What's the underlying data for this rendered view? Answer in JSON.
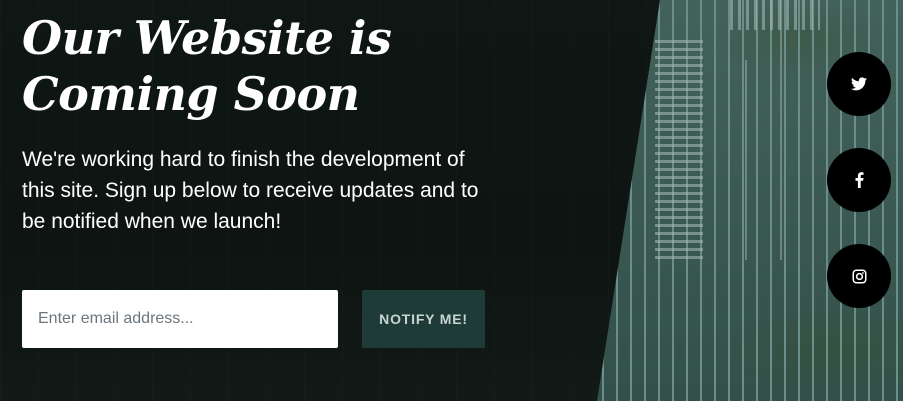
{
  "hero": {
    "title_line1": "Our Website is",
    "title_line2": "Coming Soon",
    "description": "We're working hard to finish the development of this site. Sign up below to receive updates and to be notified when we launch!"
  },
  "signup": {
    "email_placeholder": "Enter email address...",
    "email_value": "",
    "button_label": "NOTIFY ME!"
  },
  "social": [
    {
      "name": "twitter",
      "icon": "twitter-icon"
    },
    {
      "name": "facebook",
      "icon": "facebook-icon"
    },
    {
      "name": "instagram",
      "icon": "instagram-icon"
    }
  ],
  "colors": {
    "background": "#0e1513",
    "button": "#1f3b37",
    "button_text": "#c8d6d3",
    "social_circle": "#000000",
    "text": "#ffffff"
  }
}
